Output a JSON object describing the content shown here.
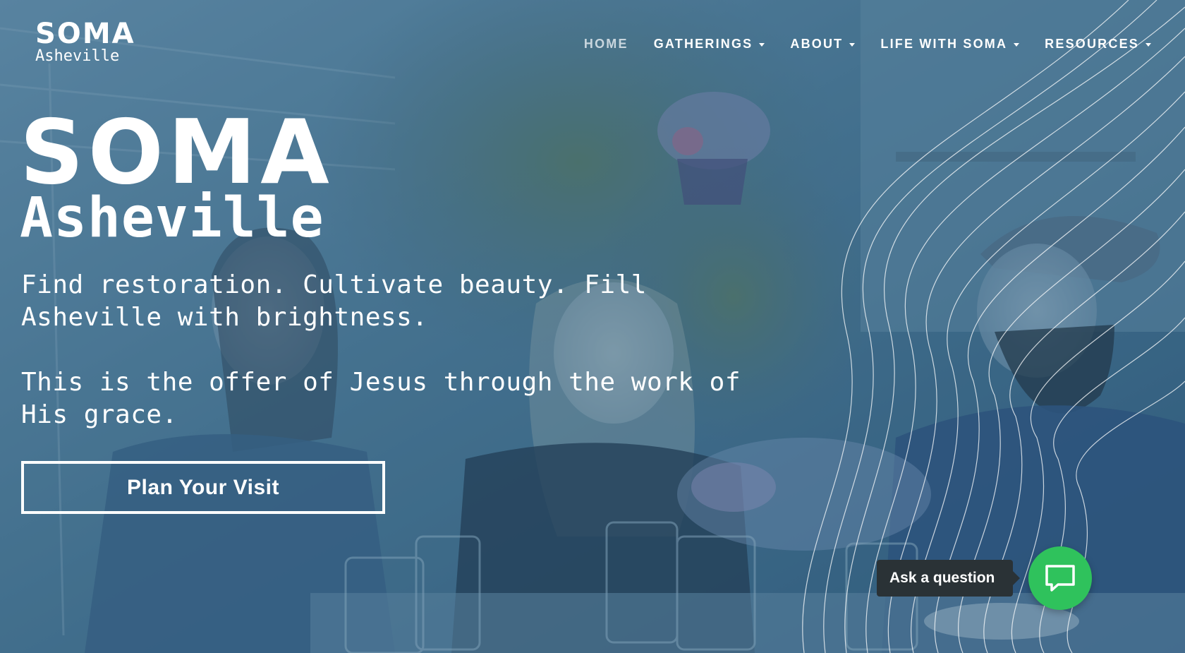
{
  "logo": {
    "mark": "SOMA",
    "city": "Asheville"
  },
  "nav": {
    "items": [
      {
        "label": "HOME",
        "active": true,
        "dropdown": false
      },
      {
        "label": "GATHERINGS",
        "active": false,
        "dropdown": true
      },
      {
        "label": "ABOUT",
        "active": false,
        "dropdown": true
      },
      {
        "label": "LIFE WITH SOMA",
        "active": false,
        "dropdown": true
      },
      {
        "label": "RESOURCES",
        "active": false,
        "dropdown": true
      }
    ]
  },
  "hero": {
    "title": "SOMA",
    "subtitle": "Asheville",
    "tagline_1": "Find restoration. Cultivate beauty. Fill Asheville with brightness.",
    "tagline_2": "This is the offer of Jesus through the work of His grace.",
    "cta_label": "Plan Your Visit"
  },
  "chat": {
    "label": "Ask a question",
    "icon": "chat-bubble-icon",
    "color": "#2fc25c"
  },
  "colors": {
    "overlay": "#3f6d8a",
    "text": "#ffffff"
  }
}
